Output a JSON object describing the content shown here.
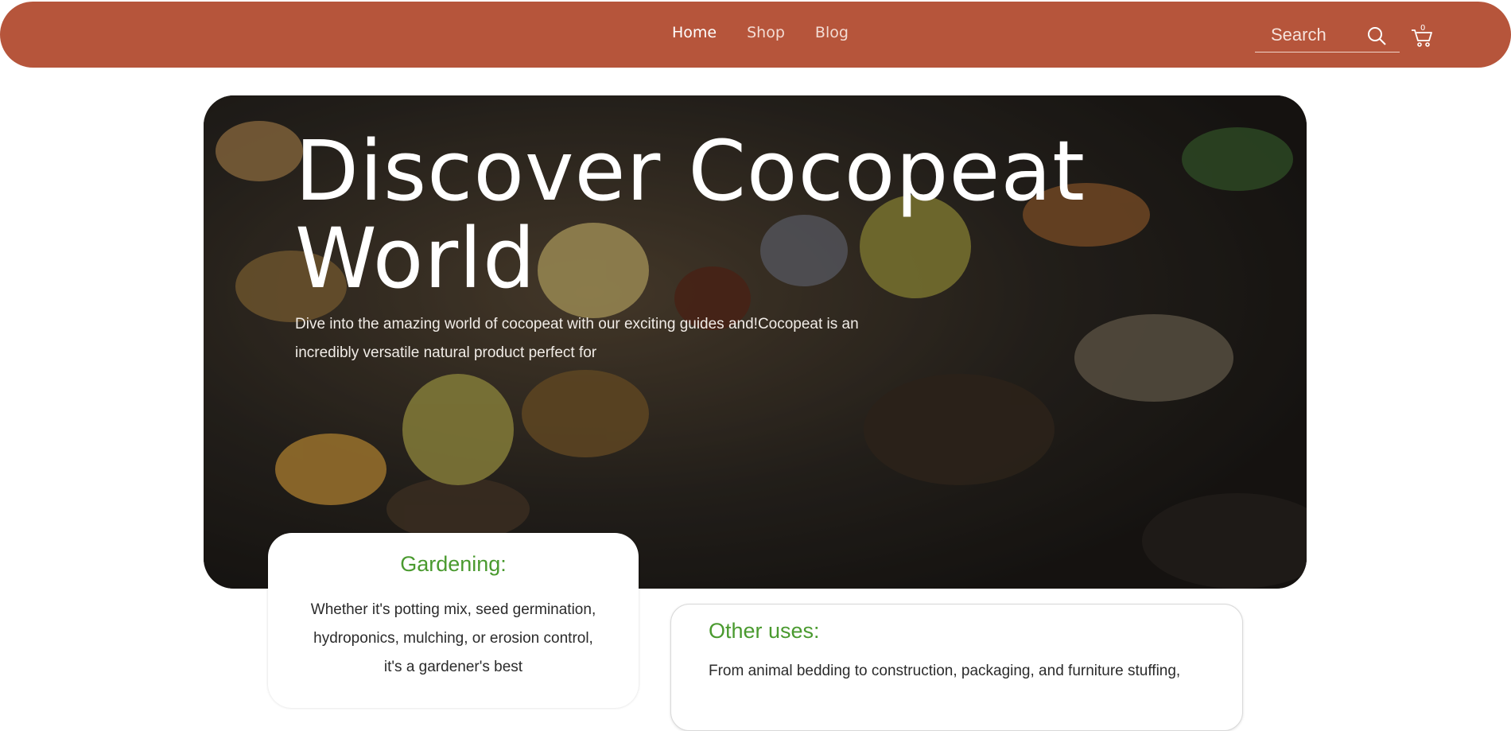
{
  "header": {
    "nav": [
      {
        "label": "Home",
        "active": true
      },
      {
        "label": "Shop",
        "active": false
      },
      {
        "label": "Blog",
        "active": false
      }
    ],
    "search": {
      "placeholder": "Search",
      "icon": "search-icon"
    },
    "cart": {
      "count": "0",
      "icon": "cart-icon"
    },
    "color": "#b6553b"
  },
  "hero": {
    "title": "Discover Cocopeat World",
    "text": "Dive into the amazing world of cocopeat with our exciting guides and!Cocopeat is an incredibly versatile natural product perfect for"
  },
  "cards": {
    "gardening": {
      "title": "Gardening:",
      "text": "Whether it's potting mix, seed germination, hydroponics, mulching, or erosion control, it's a gardener's best"
    },
    "other": {
      "title": "Other uses:",
      "text": "From animal bedding to construction, packaging, and furniture stuffing,"
    }
  },
  "colors": {
    "accent_green": "#4a9a2f",
    "header_bg": "#b6553b"
  }
}
